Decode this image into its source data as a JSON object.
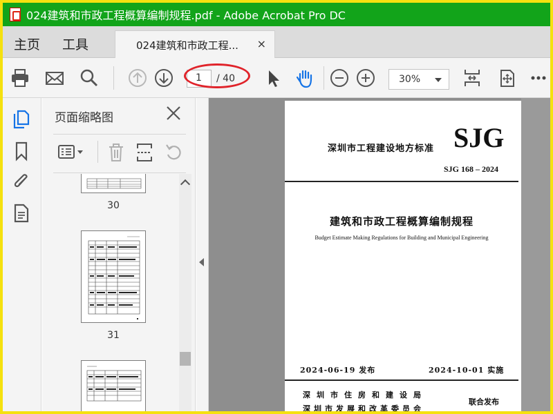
{
  "window": {
    "title": "024建筑和市政工程概算编制规程.pdf - Adobe Acrobat Pro DC"
  },
  "menu": {
    "home": "主页",
    "tools": "工具"
  },
  "doc_tab": {
    "label": "024建筑和市政工程...",
    "close": "×"
  },
  "toolbar": {
    "current_page": "1",
    "total_pages": "/ 40",
    "zoom": "30%"
  },
  "thumbnail_panel": {
    "title": "页面缩略图",
    "close": "×",
    "thumbs": [
      {
        "label": "30"
      },
      {
        "label": "31"
      }
    ]
  },
  "page": {
    "standard_label": "深圳市工程建设地方标准",
    "logo": "SJG",
    "code": "SJG 168 – 2024",
    "title_cn": "建筑和市政工程概算编制规程",
    "title_en": "Budget Estimate Making Regulations for Building and Municipal Engineering",
    "issue_date": "2024-06-19 发布",
    "effective_date": "2024-10-01 实施",
    "issuer1": "深圳市住房和建设局",
    "issuer2": "深圳市发展和改革委员会",
    "joint": "联合发布"
  },
  "colors": {
    "titlebar": "#12a41a",
    "outer_border": "#f5e10f",
    "active_icon": "#1473e6",
    "annotation_oval": "#e0232a"
  }
}
